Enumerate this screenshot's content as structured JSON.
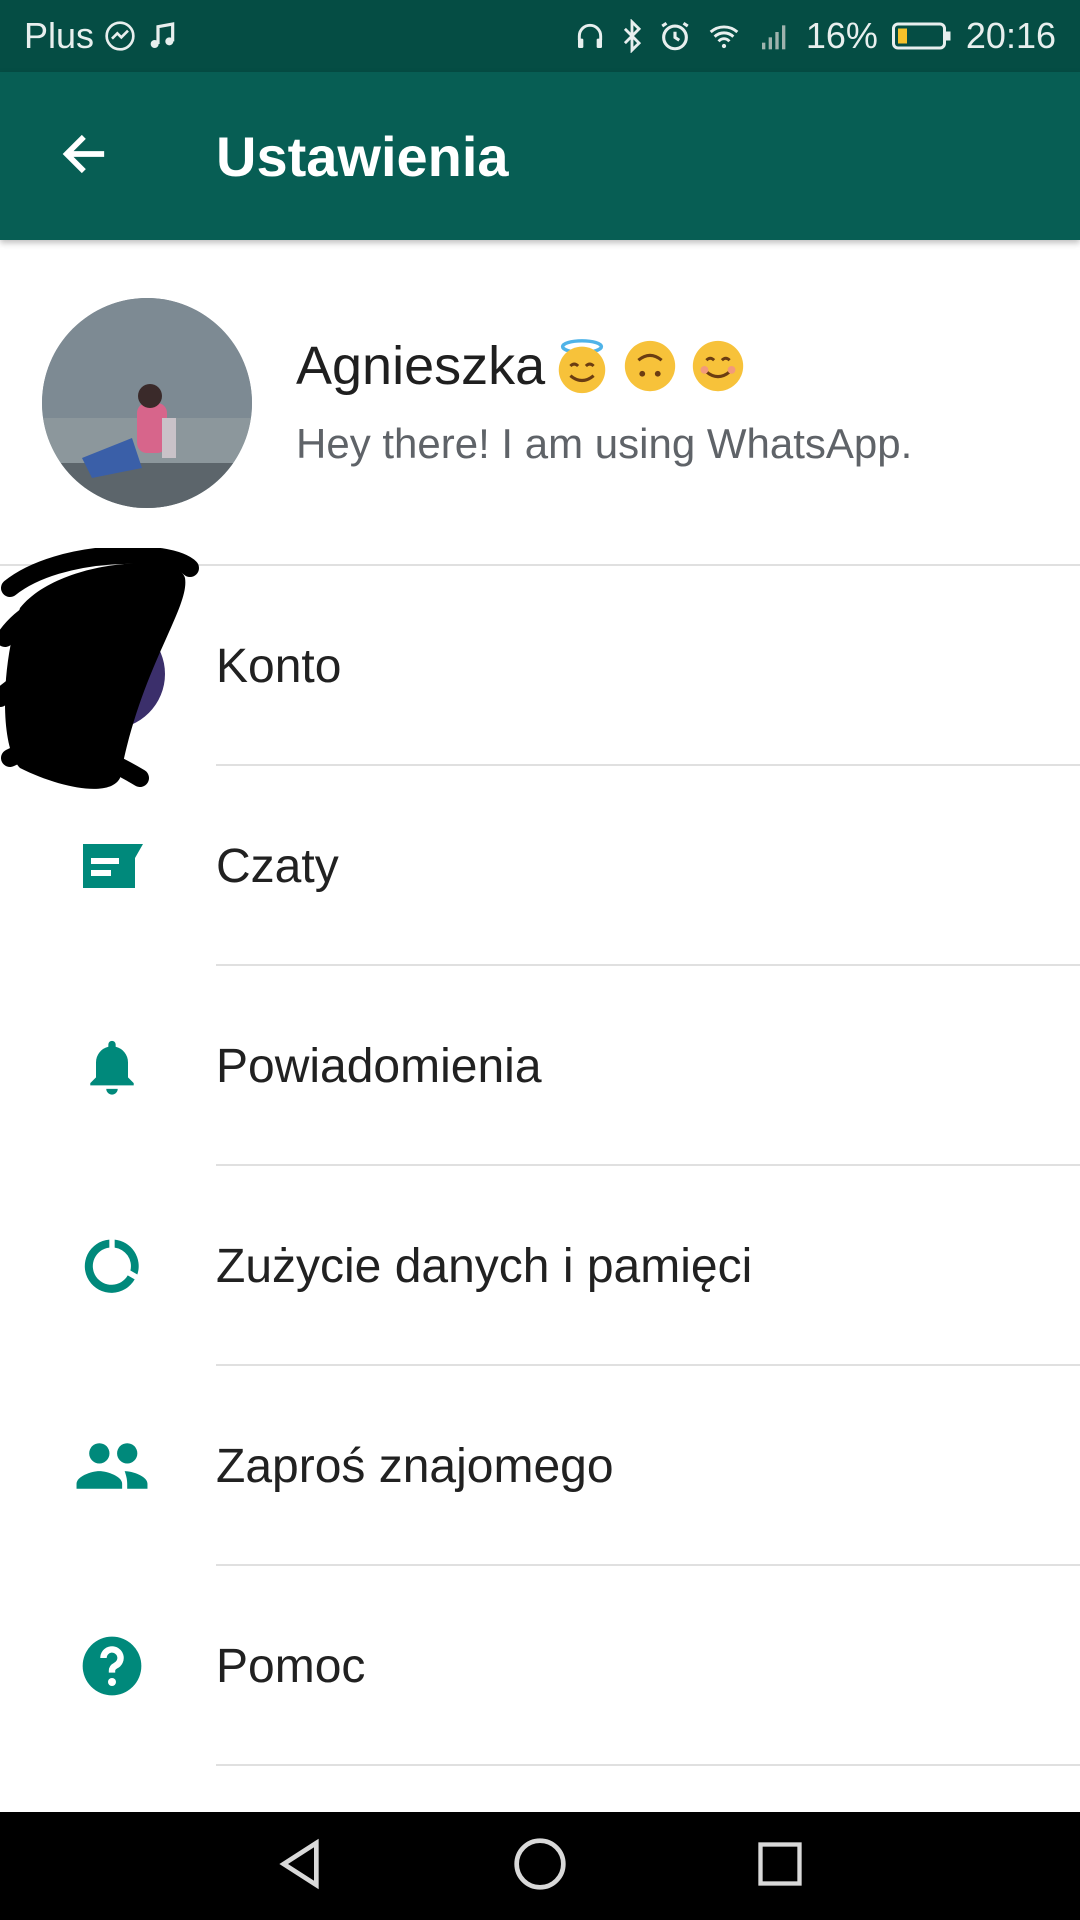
{
  "status_bar": {
    "carrier": "Plus",
    "battery_percent": "16%",
    "time": "20:16",
    "icons_left": [
      "messenger-icon",
      "music-note-icon"
    ],
    "icons_right": [
      "headset-icon",
      "bluetooth-icon",
      "alarm-icon",
      "wifi-icon",
      "signal-icon",
      "battery-icon"
    ]
  },
  "app_bar": {
    "title": "Ustawienia",
    "back_icon": "arrow-back-icon"
  },
  "profile": {
    "name": "Agnieszka",
    "emojis": [
      "smiling-face-with-halo-emoji",
      "upside-down-face-emoji",
      "smiling-face-emoji"
    ],
    "status": "Hey there! I am using WhatsApp."
  },
  "menu": {
    "items": [
      {
        "label": "Konto",
        "icon": "key-icon"
      },
      {
        "label": "Czaty",
        "icon": "chat-icon"
      },
      {
        "label": "Powiadomienia",
        "icon": "bell-icon"
      },
      {
        "label": "Zużycie danych i pamięci",
        "icon": "data-usage-icon"
      },
      {
        "label": "Zaproś znajomego",
        "icon": "people-icon"
      },
      {
        "label": "Pomoc",
        "icon": "help-icon"
      }
    ]
  },
  "nav_bar": {
    "buttons": [
      "back-triangle-icon",
      "home-circle-icon",
      "recents-square-icon"
    ]
  },
  "colors": {
    "status_bar": "#054d44",
    "app_bar": "#075e54",
    "accent": "#00897b"
  }
}
